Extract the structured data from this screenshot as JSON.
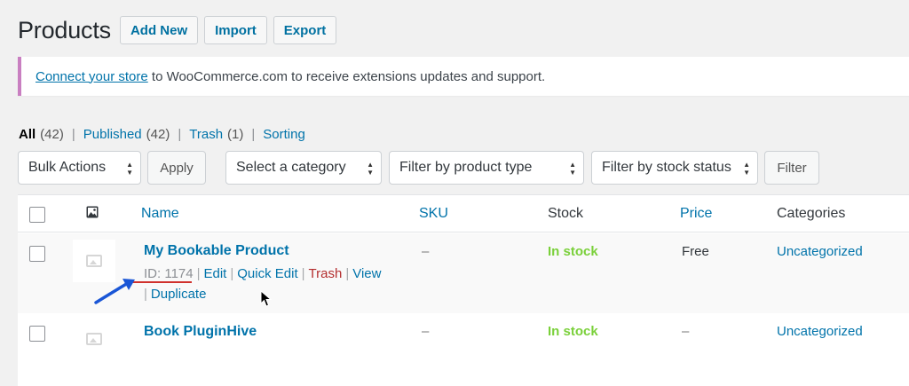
{
  "header": {
    "title": "Products",
    "buttons": [
      "Add New",
      "Import",
      "Export"
    ]
  },
  "notice": {
    "link": "Connect your store",
    "text": " to WooCommerce.com to receive extensions updates and support."
  },
  "views": {
    "all_label": "All",
    "all_count": "(42)",
    "published_label": "Published",
    "published_count": "(42)",
    "trash_label": "Trash",
    "trash_count": "(1)",
    "sorting_label": "Sorting",
    "separator": "|"
  },
  "filters": {
    "bulk_actions": "Bulk Actions",
    "apply": "Apply",
    "category": "Select a category",
    "product_type": "Filter by product type",
    "stock_status": "Filter by stock status",
    "filter": "Filter"
  },
  "table": {
    "columns": {
      "name": "Name",
      "sku": "SKU",
      "stock": "Stock",
      "price": "Price",
      "categories": "Categories"
    },
    "rows": [
      {
        "name": "My Bookable Product",
        "id_label": "ID: 1174",
        "actions": [
          "Edit",
          "Quick Edit",
          "Trash",
          "View",
          "Duplicate"
        ],
        "sku": "–",
        "stock": "In stock",
        "price": "Free",
        "category": "Uncategorized"
      },
      {
        "name": "Book PluginHive",
        "sku": "–",
        "stock": "In stock",
        "price": "–",
        "category": "Uncategorized"
      }
    ]
  },
  "colors": {
    "link": "#0073aa",
    "in_stock": "#7ad03a",
    "trash": "#b32d2e",
    "notice_border": "#c97fc1",
    "annotation_arrow": "#1a56d6",
    "annotation_underline": "#d0312d"
  },
  "icons": {
    "image_column": "image-icon",
    "thumbnail": "placeholder-image-icon",
    "annotation": "arrow-annotation-icon",
    "cursor": "mouse-cursor-icon"
  }
}
